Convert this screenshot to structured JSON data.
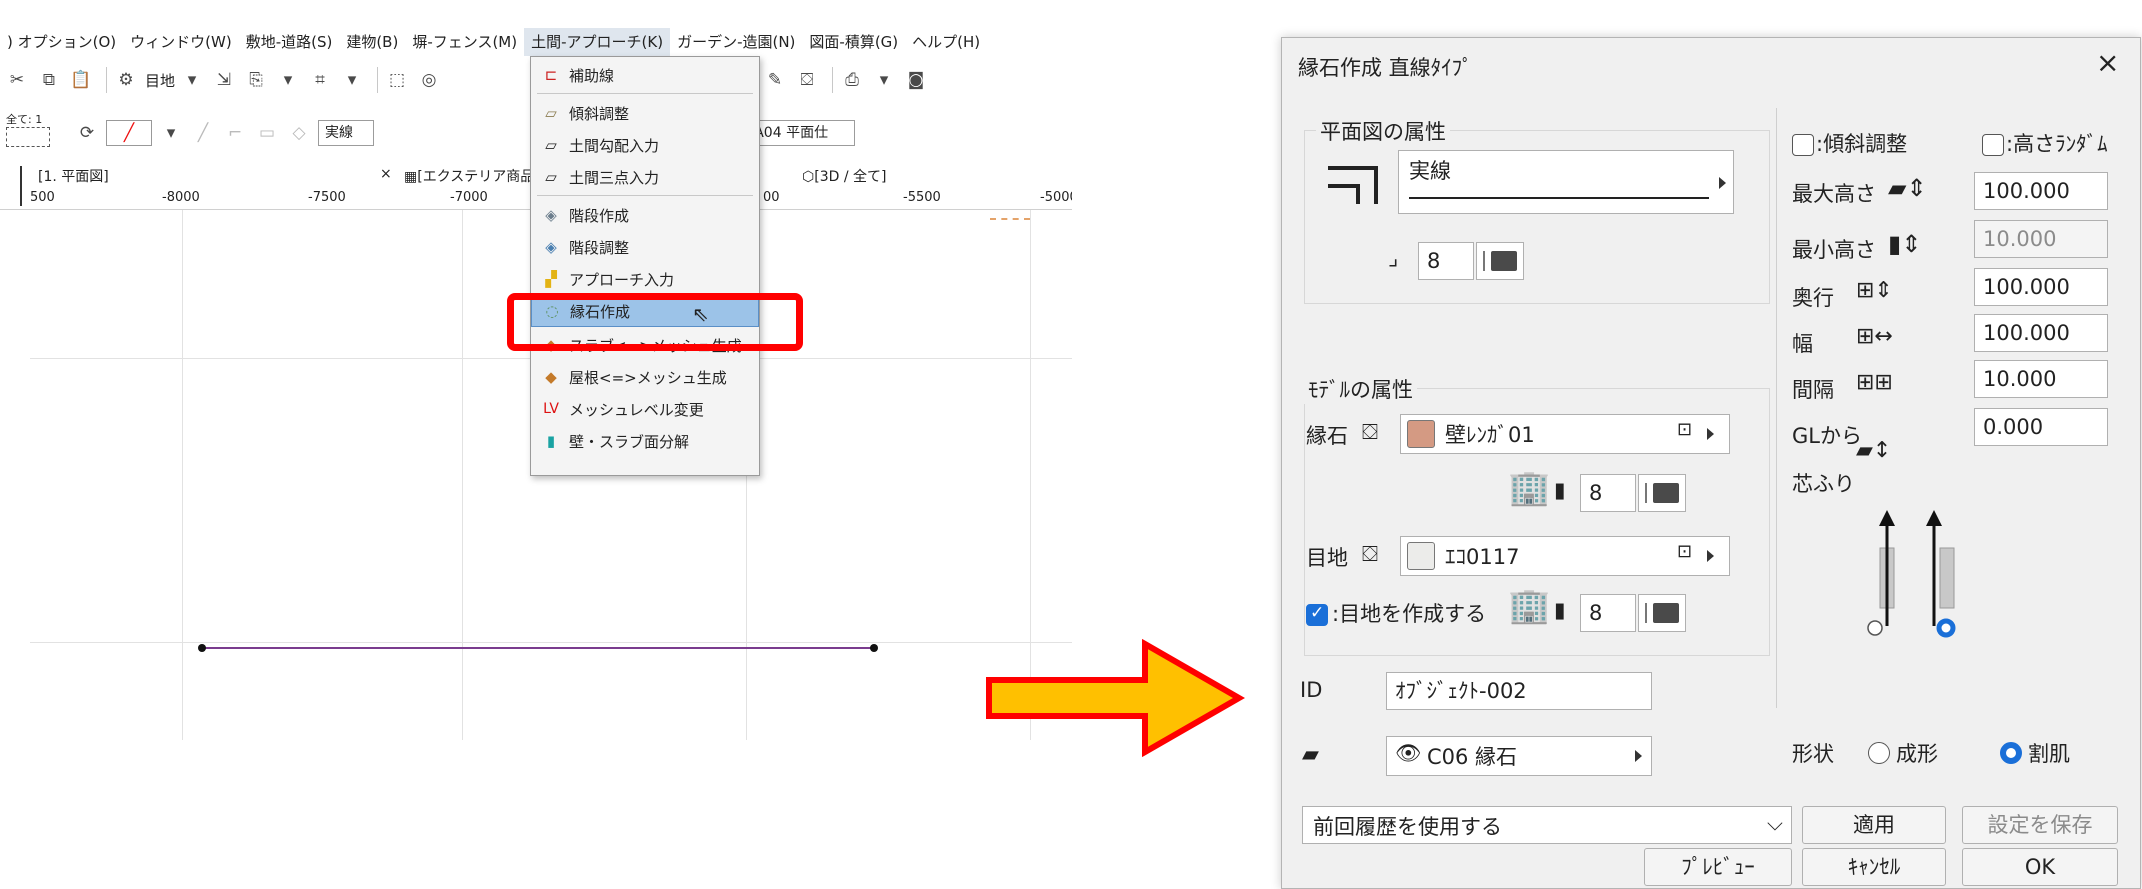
{
  "menubar": {
    "items": [
      ") オプション(O)",
      "ウィンドウ(W)",
      "敷地-道路(S)",
      "建物(B)",
      "塀-フェンス(M)",
      "土間-アプローチ(K)",
      "ガーデン-造園(N)",
      "図面-積算(G)",
      "ヘルプ(H)"
    ]
  },
  "toolbar": {
    "row1_label": "目地",
    "row2_small": "全て: 1",
    "linetype": "実線",
    "pen_number": "1",
    "layer_label": "A04 平面仕"
  },
  "tabs": {
    "plan": "[1. 平面図]",
    "close": "×",
    "exterior": "[エクステリア商品",
    "view3d": "[3D / 全て]"
  },
  "ruler": {
    "left": [
      "500",
      "-8000",
      "-7500",
      "-7000"
    ],
    "right": [
      "00",
      "-5500",
      "-5000"
    ]
  },
  "dropdown": {
    "items": [
      {
        "icon": "guide-line-icon",
        "label": "補助線"
      },
      {
        "icon": "slope-adjust-icon",
        "label": "傾斜調整"
      },
      {
        "icon": "slab-slope-icon",
        "label": "土間勾配入力"
      },
      {
        "icon": "three-point-icon",
        "label": "土間三点入力"
      },
      {
        "icon": "stair-create-icon",
        "label": "階段作成"
      },
      {
        "icon": "stair-adjust-icon",
        "label": "階段調整"
      },
      {
        "icon": "approach-icon",
        "label": "アプローチ入力"
      },
      {
        "icon": "edging-stone-icon",
        "label": "縁石作成"
      },
      {
        "icon": "slab-mesh-icon",
        "label": "スラブ<=>メッシュ生成"
      },
      {
        "icon": "roof-mesh-icon",
        "label": "屋根<=>メッシュ生成"
      },
      {
        "icon": "mesh-level-icon",
        "label": "メッシュレベル変更",
        "glyph": "LV"
      },
      {
        "icon": "wall-slab-icon",
        "label": "壁・スラブ面分解"
      }
    ],
    "highlighted": "縁石作成"
  },
  "dialog": {
    "title": "縁石作成 直線ﾀｲﾌﾟ",
    "close": "×",
    "plan_group": "平面図の属性",
    "line_type": "実線",
    "pen1": "8",
    "model_group": "ﾓﾃﾞﾙの属性",
    "curb_label": "縁石",
    "curb_material": "壁ﾚﾝｶﾞ01",
    "curb_color": "#d49a83",
    "pen2": "8",
    "joint_label": "目地",
    "joint_material": "ｴｺ0117",
    "joint_color": "#ececea",
    "joint_check_label": ":目地を作成する",
    "joint_checked": true,
    "pen3": "8",
    "id_label": "ID",
    "id_value": "ｵﾌﾞｼﾞｪｸﾄ-002",
    "layer_value": "C06 縁石",
    "slope_label": ":傾斜調整",
    "random_height_label": ":高さﾗﾝﾀﾞﾑ",
    "max_height_label": "最大高さ",
    "max_height": "100.000",
    "min_height_label": "最小高さ",
    "min_height": "10.000",
    "depth_label": "奥行",
    "depth": "100.000",
    "width_label": "幅",
    "width": "100.000",
    "spacing_label": "間隔",
    "spacing": "10.000",
    "gl_label": "GLから",
    "gl": "0.000",
    "offset_label": "芯ふり",
    "shape_label": "形状",
    "shape_opt1": "成形",
    "shape_opt2": "割肌",
    "shape_selected": "割肌",
    "history": "前回履歴を使用する",
    "apply": "適用",
    "save": "設定を保存",
    "preview": "ﾌﾟﾚﾋﾞｭｰ",
    "cancel": "ｷｬﾝｾﾙ",
    "ok": "OK"
  },
  "colors": {
    "highlight_box": "#ff0000",
    "arrow_fill": "#ffc000",
    "arrow_stroke": "#ff0000",
    "menu_highlight": "#9cc3e8",
    "accent": "#1a6fd8",
    "wall_line": "#7a3c8e"
  }
}
